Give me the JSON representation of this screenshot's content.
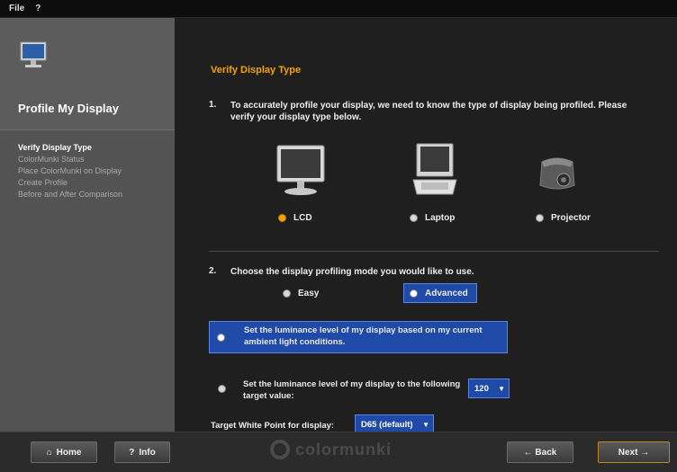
{
  "menubar": {
    "items": [
      "File",
      "?"
    ]
  },
  "sidebar": {
    "title": "Profile My Display",
    "steps": [
      "Verify Display Type",
      "ColorMunki Status",
      "Place ColorMunki on Display",
      "Create Profile",
      "Before and After Comparison"
    ],
    "active_step": 0
  },
  "main": {
    "section_title": "Verify Display Type",
    "step1": {
      "num": "1.",
      "text": "To accurately profile your display, we need to know the type of display being profiled. Please verify your display type below."
    },
    "devices": [
      {
        "label": "LCD",
        "icon": "lcd-monitor-icon",
        "selected": true
      },
      {
        "label": "Laptop",
        "icon": "laptop-icon",
        "selected": false
      },
      {
        "label": "Projector",
        "icon": "projector-icon",
        "selected": false
      }
    ],
    "step2": {
      "num": "2.",
      "text": "Choose the display profiling mode you would like to use."
    },
    "modes": [
      {
        "label": "Easy",
        "selected": false
      },
      {
        "label": "Advanced",
        "selected": true
      }
    ],
    "luminance": {
      "option1": "Set the luminance level of my display based on my current ambient light conditions.",
      "option2": "Set the luminance level of my display to the following target value:",
      "target_value": "120"
    },
    "white_point": {
      "label": "Target White Point for display:",
      "value": "D65 (default)"
    }
  },
  "footer": {
    "home": "Home",
    "info": "Info",
    "logo": "colormunki",
    "back": "← Back",
    "next": "Next →"
  },
  "colors": {
    "accent": "#f0a500",
    "selection": "#1f4aa8",
    "sidebar": "#535353"
  }
}
